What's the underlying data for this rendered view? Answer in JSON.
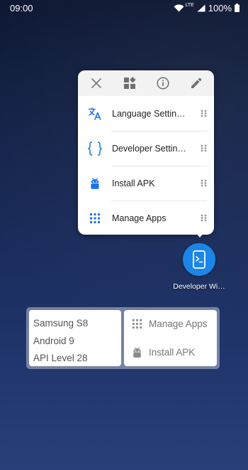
{
  "status_bar": {
    "time": "09:00",
    "network": "LTE",
    "battery": "100%"
  },
  "popup": {
    "toolbar": [
      {
        "icon": "close-icon"
      },
      {
        "icon": "widgets-icon"
      },
      {
        "icon": "info-icon"
      },
      {
        "icon": "edit-icon"
      }
    ],
    "items": [
      {
        "label": "Language Settin…",
        "icon": "translate-icon"
      },
      {
        "label": "Developer Settin…",
        "icon": "braces-icon"
      },
      {
        "label": "Install APK",
        "icon": "android-icon"
      },
      {
        "label": "Manage Apps",
        "icon": "apps-grid-icon"
      }
    ]
  },
  "app": {
    "label": "Developer Wi…",
    "icon": "terminal-icon",
    "accent": "#1a86e8"
  },
  "widget": {
    "device": "Samsung S8",
    "android": "Android 9",
    "api": "API Level 28",
    "actions": [
      {
        "label": "Manage Apps",
        "icon": "apps-grid-icon"
      },
      {
        "label": "Install APK",
        "icon": "android-icon"
      }
    ]
  },
  "colors": {
    "accent_blue": "#1a73e8",
    "android_gray": "#8a8a8a"
  }
}
